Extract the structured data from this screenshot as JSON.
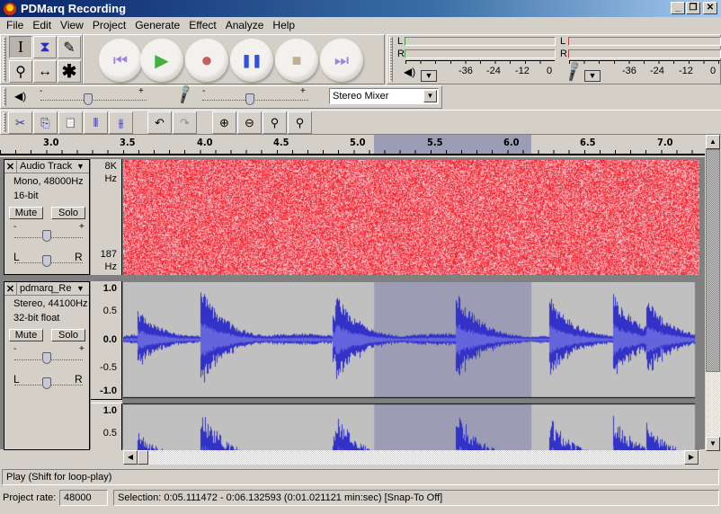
{
  "window": {
    "title": "PDMarq Recording",
    "controls": {
      "minimize": "_",
      "restore": "❐",
      "close": "✕"
    }
  },
  "menu": [
    "File",
    "Edit",
    "View",
    "Project",
    "Generate",
    "Effect",
    "Analyze",
    "Help"
  ],
  "tools": [
    {
      "name": "selection-tool",
      "glyph": "I",
      "active": true
    },
    {
      "name": "envelope-tool",
      "glyph": "⧗",
      "active": false
    },
    {
      "name": "draw-tool",
      "glyph": "✎",
      "active": false
    },
    {
      "name": "zoom-tool",
      "glyph": "⚲",
      "active": false
    },
    {
      "name": "timeshift-tool",
      "glyph": "↔",
      "active": false
    },
    {
      "name": "multi-tool",
      "glyph": "✱",
      "active": false
    }
  ],
  "transport": [
    {
      "name": "skip-start",
      "glyph": "⏮",
      "color": "#a080e0"
    },
    {
      "name": "play",
      "glyph": "▶",
      "color": "#44b044"
    },
    {
      "name": "record",
      "glyph": "●",
      "color": "#c06060"
    },
    {
      "name": "pause",
      "glyph": "❚❚",
      "color": "#3050e0"
    },
    {
      "name": "stop",
      "glyph": "■",
      "color": "#c0b090"
    },
    {
      "name": "skip-end",
      "glyph": "⏭",
      "color": "#a080e0"
    }
  ],
  "meters": {
    "channels": [
      "L",
      "R"
    ],
    "scale": [
      "-36",
      "-24",
      "-12",
      "0"
    ]
  },
  "mixer": {
    "playback_volume": 0.45,
    "record_volume": 0.45,
    "input_source": "Stereo Mixer",
    "minus": "-",
    "plus": "+"
  },
  "edit_tools": [
    {
      "name": "cut",
      "glyph": "✂"
    },
    {
      "name": "copy",
      "glyph": "⎘"
    },
    {
      "name": "paste",
      "glyph": "📋"
    },
    {
      "name": "trim",
      "glyph": "⫴"
    },
    {
      "name": "silence",
      "glyph": "⫵"
    },
    {
      "name": "undo",
      "glyph": "↶"
    },
    {
      "name": "redo",
      "glyph": "↷"
    },
    {
      "name": "zoom-in",
      "glyph": "⊕"
    },
    {
      "name": "zoom-out",
      "glyph": "⊖"
    },
    {
      "name": "fit-selection",
      "glyph": "⚲"
    },
    {
      "name": "fit-project",
      "glyph": "⚲"
    }
  ],
  "ruler": {
    "labels": [
      "3.0",
      "3.5",
      "4.0",
      "4.5",
      "5.0",
      "5.5",
      "6.0",
      "6.5",
      "7.0"
    ],
    "selection_start": 5.111472,
    "selection_end": 6.132593
  },
  "tracks": [
    {
      "name": "Audio Track",
      "info1": "Mono, 48000Hz",
      "info2": "16-bit",
      "mute": "Mute",
      "solo": "Solo",
      "gain_minus": "-",
      "gain_plus": "+",
      "pan_left": "L",
      "pan_right": "R",
      "view": "spectrum",
      "axis_top": "8K",
      "axis_top_unit": "Hz",
      "axis_bottom": "187",
      "axis_bottom_unit": "Hz"
    },
    {
      "name": "pdmarq_Re",
      "info1": "Stereo, 44100Hz",
      "info2": "32-bit float",
      "mute": "Mute",
      "solo": "Solo",
      "gain_minus": "-",
      "gain_plus": "+",
      "pan_left": "L",
      "pan_right": "R",
      "view": "waveform",
      "axis": [
        "1.0",
        "0.5",
        "0.0",
        "-0.5",
        "-1.0"
      ],
      "axis2": [
        "1.0",
        "0.5"
      ]
    }
  ],
  "status": {
    "message": "Play (Shift for loop-play)",
    "project_rate_label": "Project rate:",
    "project_rate": "48000",
    "selection": "Selection: 0:05.111472 - 0:06.132593 (0:01.021121 min:sec)  [Snap-To Off]"
  },
  "colors": {
    "waveform": "#3232c8",
    "waveform_rms": "#6464dc",
    "selection": "#9c9cb4",
    "track_bg": "#c0c0c0",
    "spectrum": "#e8202a"
  }
}
